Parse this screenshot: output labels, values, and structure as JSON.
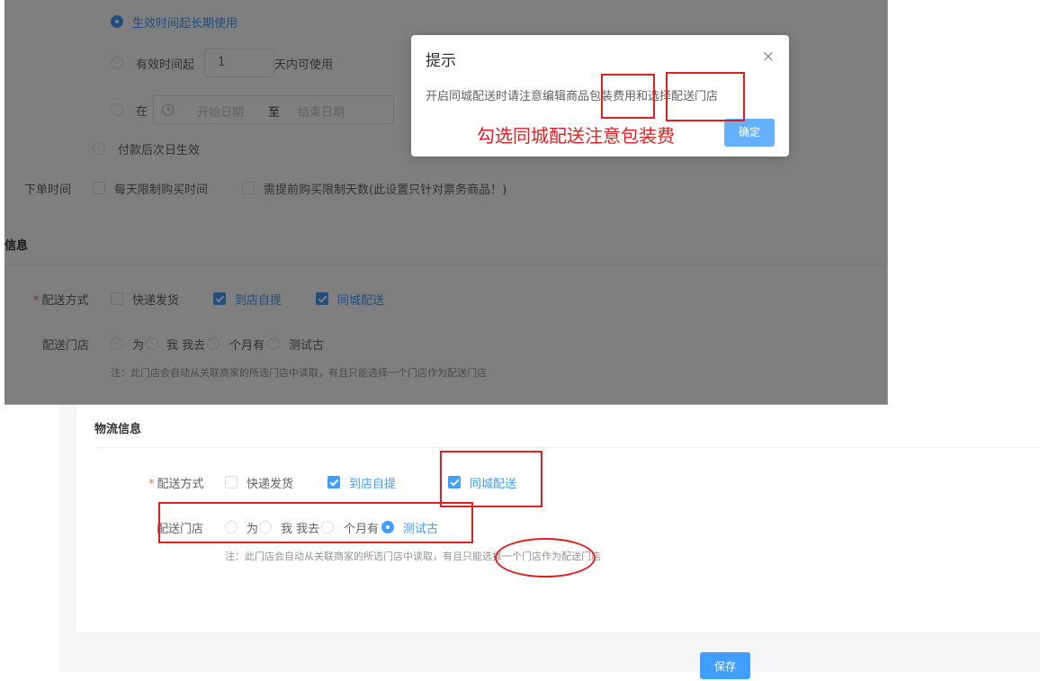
{
  "top": {
    "validity": {
      "long_term": "生效时间起长期使用",
      "within_prefix": "有效时间起",
      "within_days": "1",
      "within_suffix": "天内可使用",
      "range_prefix": "在",
      "start_placeholder": "开始日期",
      "range_sep": "至",
      "end_placeholder": "结束日期",
      "next_day": "付款后次日生效"
    },
    "order_time": {
      "label": "下单时间",
      "daily_limit": "每天限制购买时间",
      "advance_limit": "需提前购买限制天数(此设置只针对票务商品！)"
    },
    "section_title": "信息",
    "delivery": {
      "label": "配送方式",
      "express": "快递发货",
      "pickup": "到店自提",
      "city": "同城配送"
    },
    "stores": {
      "label": "配送门店",
      "options": [
        "为",
        "我 我去",
        "个月有",
        "测试古"
      ]
    },
    "note": "注：此门店会自动从关联商家的所选门店中读取，有且只能选择一个门店作为配送门店"
  },
  "modal": {
    "title": "提示",
    "close": "×",
    "message": "开启同城配送时请注意编辑商品包装费用和选择配送门店",
    "ok": "确定"
  },
  "annotation": "勾选同城配送注意包装费",
  "bottom": {
    "section_title": "物流信息",
    "delivery": {
      "label": "配送方式",
      "express": "快递发货",
      "pickup": "到店自提",
      "city": "同城配送"
    },
    "stores": {
      "label": "配送门店",
      "options": [
        "为",
        "我 我去",
        "个月有",
        "测试古"
      ]
    },
    "note": "注：此门店会自动从关联商家的所选门店中读取，有且只能选择一个门店作为配送门店",
    "save": "保存"
  },
  "colors": {
    "accent": "#409eff",
    "annotation_red": "#e02020"
  },
  "icons": [
    "clock-icon",
    "close-icon",
    "check-icon"
  ]
}
